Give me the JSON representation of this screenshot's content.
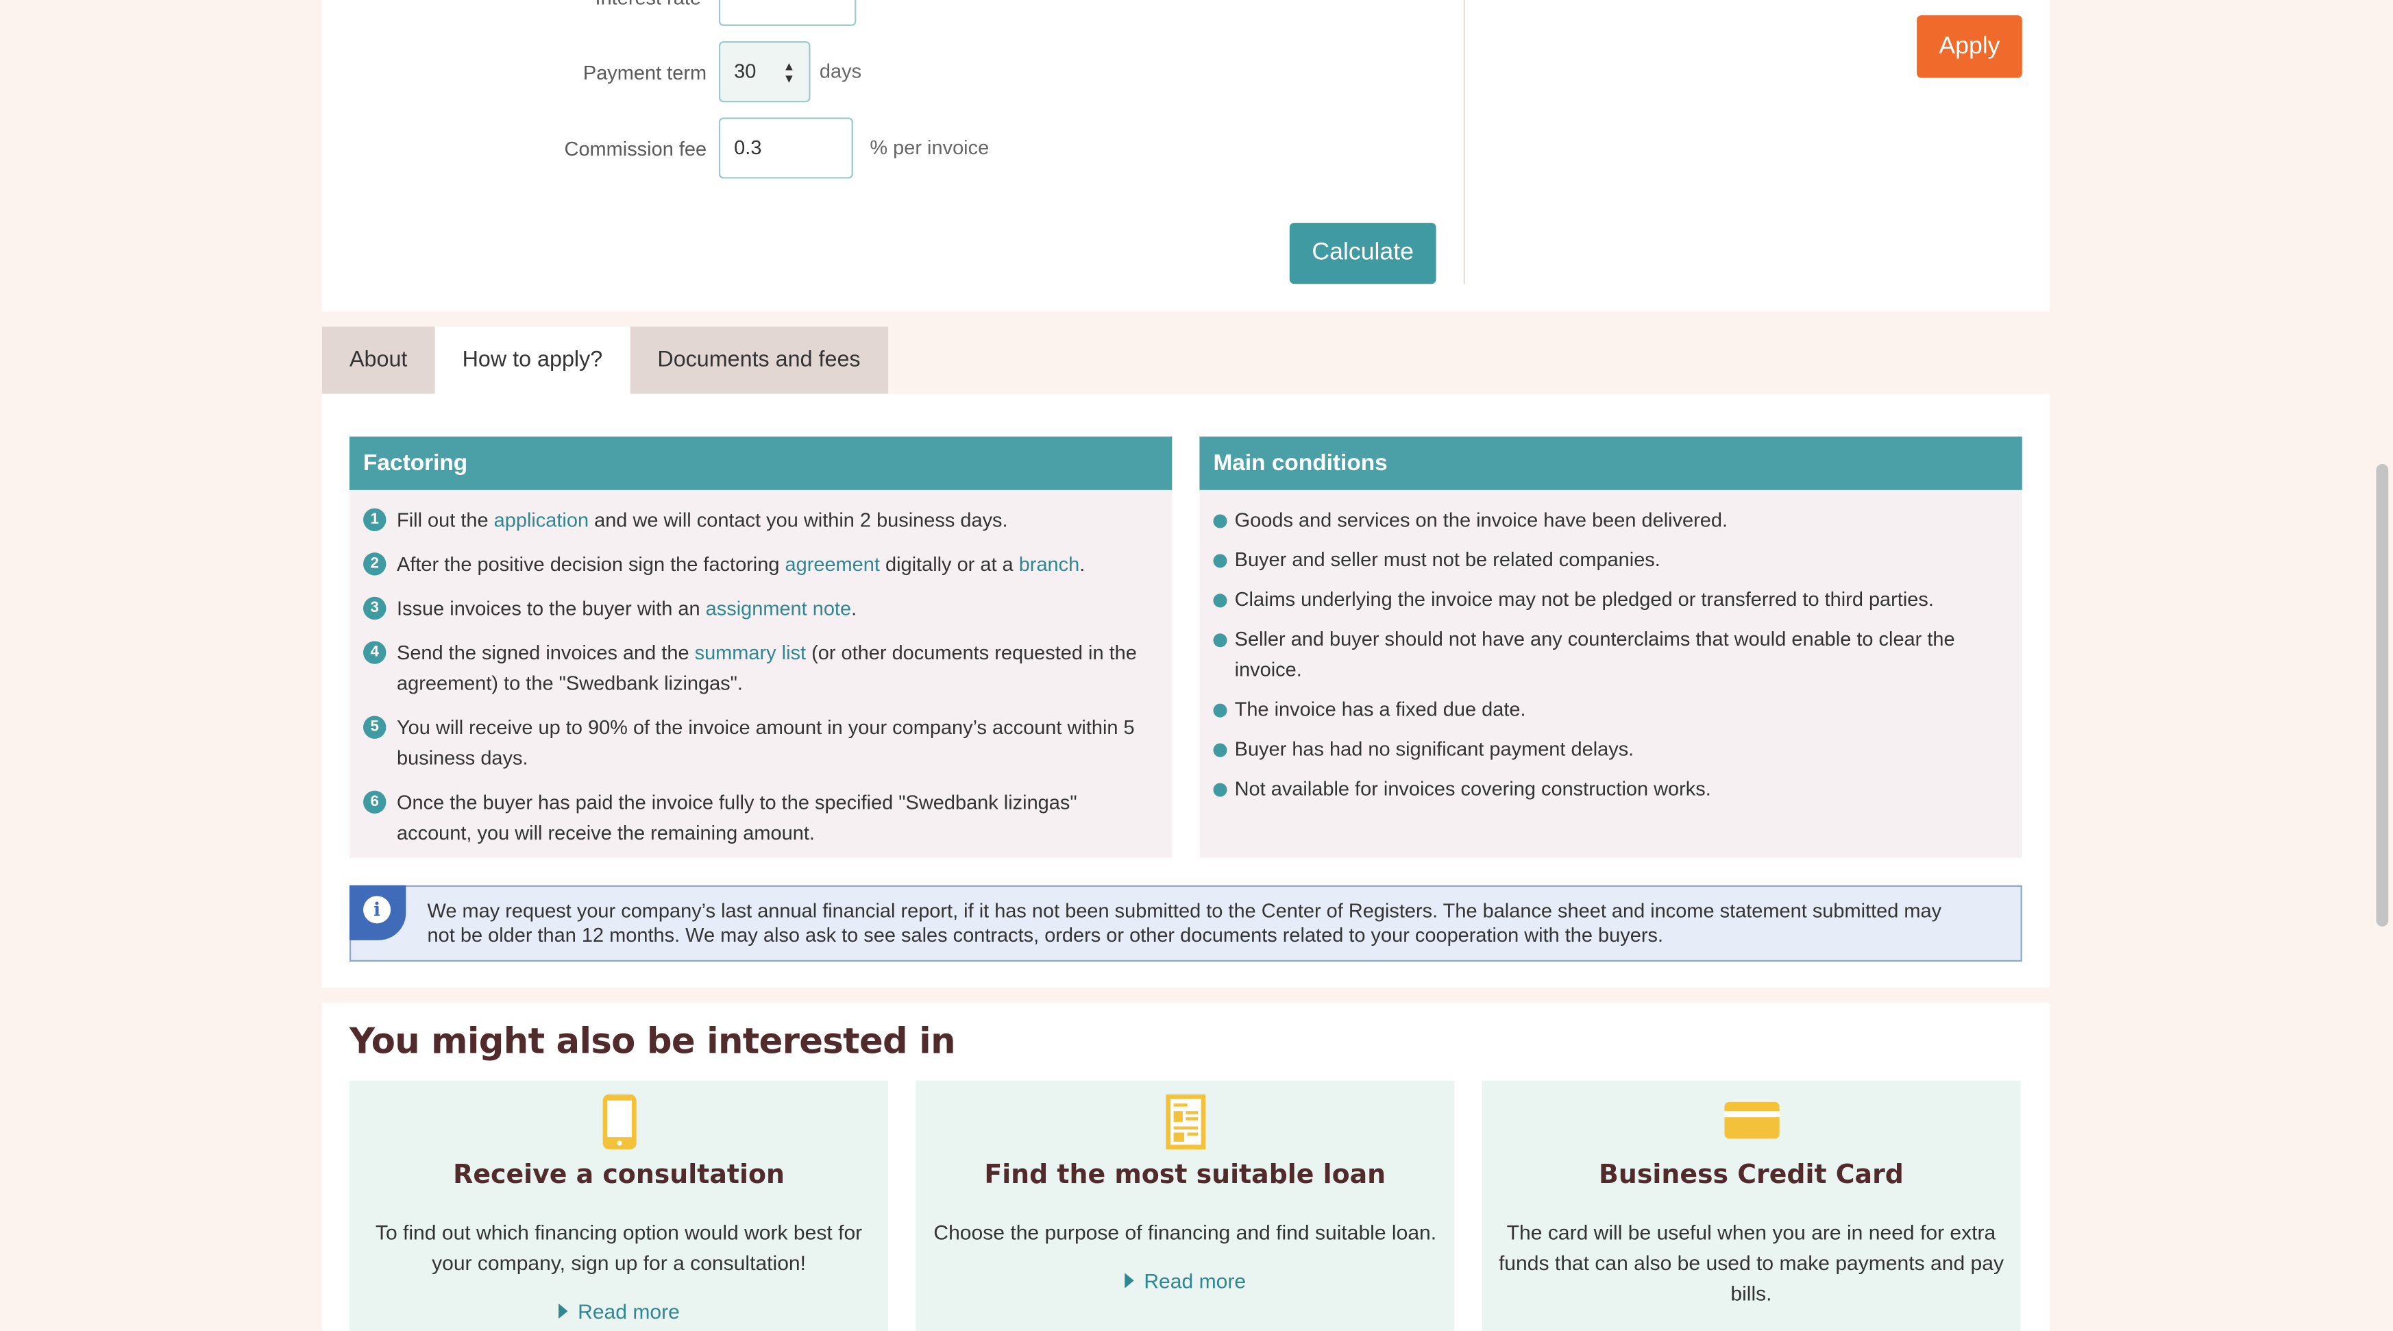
{
  "calculator": {
    "interest_rate_label": "Interest rate",
    "payment_term_label": "Payment term",
    "payment_term_value": "30",
    "payment_term_unit": "days",
    "commission_fee_label": "Commission fee",
    "commission_fee_value": "0.3",
    "commission_fee_unit": "% per invoice",
    "calculate_label": "Calculate",
    "apply_label": "Apply"
  },
  "tabs": [
    {
      "label": "About"
    },
    {
      "label": "How to apply?"
    },
    {
      "label": "Documents and fees"
    }
  ],
  "factoring": {
    "title": "Factoring",
    "steps": [
      {
        "num": "1",
        "pre": "Fill out the ",
        "link": "application",
        "post": " and we will contact you within 2 business days."
      },
      {
        "num": "2",
        "pre": "After the positive decision sign the factoring ",
        "link": "agreement",
        "mid": " digitally or at a ",
        "link2": "branch",
        "post": "."
      },
      {
        "num": "3",
        "pre": "Issue invoices to the buyer with an ",
        "link": "assignment note",
        "post": "."
      },
      {
        "num": "4",
        "pre": "Send the signed invoices and the ",
        "link": "summary list",
        "post": " (or other documents requested in the agreement) to the \"Swedbank lizingas\"."
      },
      {
        "num": "5",
        "text": "You will receive up to 90% of the invoice amount in your company’s account within 5 business days."
      },
      {
        "num": "6",
        "text": "Once the buyer has paid the invoice fully to the specified \"Swedbank lizingas\" account, you will receive the remaining amount."
      }
    ]
  },
  "conditions": {
    "title": "Main conditions",
    "items": [
      "Goods and services on the invoice have been delivered.",
      "Buyer and seller must not be related companies.",
      "Claims underlying the invoice may not be pledged or transferred to third parties.",
      "Seller and buyer should not have any counterclaims that would enable to clear the invoice.",
      "The invoice has a fixed due date.",
      "Buyer has had no significant payment delays.",
      "Not available for invoices covering construction works."
    ]
  },
  "info_note": "We may request your company’s last annual financial report, if it has not been submitted to the Center of Registers. The balance sheet and income statement submitted may not be older than 12 months. We may also ask to see sales contracts, orders or other documents related to your cooperation with the buyers.",
  "interest": {
    "heading": "You might also be interested in",
    "tiles": [
      {
        "icon": "phone-icon",
        "title": "Receive a consultation",
        "text": "To find out which financing option would work best for your company, sign up for a consultation!",
        "more": "Read more"
      },
      {
        "icon": "document-icon",
        "title": "Find the most suitable loan",
        "text": "Choose the purpose of financing and find suitable loan.",
        "more": "Read more"
      },
      {
        "icon": "credit-card-icon",
        "title": "Business Credit Card",
        "text": "The card will be useful when you are in need for extra funds that can also be used to make payments and pay bills.",
        "more": ""
      }
    ]
  },
  "colors": {
    "teal": "#3f9aa1",
    "orange": "#f06a2b",
    "heading": "#512b2b"
  }
}
